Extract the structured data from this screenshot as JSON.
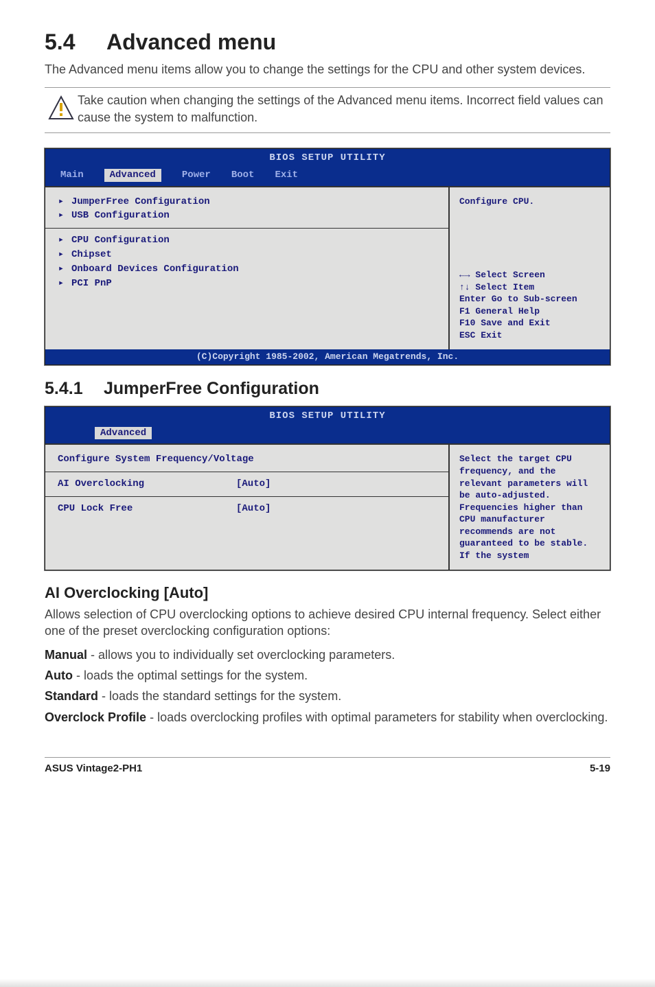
{
  "page": {
    "section_num": "5.4",
    "section_title": "Advanced menu",
    "intro": "The Advanced menu items allow you to change the settings for the CPU and other system devices.",
    "caution": "Take caution when changing the settings of the Advanced menu items. Incorrect field values can cause the system to malfunction."
  },
  "bios1": {
    "title": "BIOS SETUP UTILITY",
    "tabs": {
      "main": "Main",
      "advanced": "Advanced",
      "power": "Power",
      "boot": "Boot",
      "exit": "Exit"
    },
    "left_group1": [
      "JumperFree Configuration",
      "USB Configuration"
    ],
    "left_group2": [
      "CPU Configuration",
      "Chipset",
      "Onboard Devices Configuration",
      "PCI PnP"
    ],
    "right_help": "Configure CPU.",
    "nav": {
      "l1": "←→    Select Screen",
      "l2": "↑↓    Select Item",
      "l3": "Enter Go to Sub-screen",
      "l4": "F1    General Help",
      "l5": "F10   Save and Exit",
      "l6": "ESC   Exit"
    },
    "footer": "(C)Copyright 1985-2002, American Megatrends, Inc."
  },
  "subsection": {
    "num": "5.4.1",
    "title": "JumperFree Configuration"
  },
  "bios2": {
    "title": "BIOS SETUP UTILITY",
    "tab": "Advanced",
    "header_label": "Configure System Frequency/Voltage",
    "rows": [
      {
        "label": "AI Overclocking",
        "value": "[Auto]"
      },
      {
        "label": "CPU Lock Free",
        "value": "[Auto]"
      }
    ],
    "right_text": "Select the target CPU frequency, and the relevant parameters will be auto-adjusted. Frequencies higher than CPU manufacturer recommends are not guaranteed to be stable. If the system"
  },
  "field": {
    "title": "AI Overclocking [Auto]",
    "desc": "Allows selection of CPU overclocking options to achieve desired CPU internal frequency. Select either one of the preset overclocking configuration options:",
    "opts": {
      "manual_name": "Manual",
      "manual_desc": " - allows you to individually set overclocking parameters.",
      "auto_name": "Auto",
      "auto_desc": " - loads the optimal settings for the system.",
      "standard_name": "Standard",
      "standard_desc": " - loads the standard settings for the system.",
      "overclock_name": "Overclock Profile",
      "overclock_desc": " - loads overclocking profiles with optimal parameters for stability when overclocking."
    }
  },
  "footer": {
    "product": "ASUS Vintage2-PH1",
    "page": "5-19"
  }
}
